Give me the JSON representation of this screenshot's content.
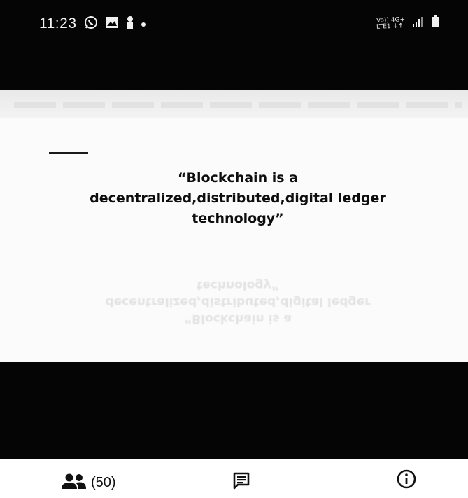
{
  "status_bar": {
    "time": "11:23",
    "network_top": "Vo)) 4G+",
    "network_bottom": "LTE1 ↓↑",
    "left_icons": [
      "whatsapp-icon",
      "gallery-icon",
      "lock-icon",
      "dot-icon"
    ],
    "right_icons": [
      "signal-icon",
      "battery-icon"
    ]
  },
  "main": {
    "quote": "“Blockchain is a decentralized,distributed,digital ledger technology”"
  },
  "bottom_nav": {
    "participants_count": "(50)",
    "items": [
      "participants-icon",
      "chat-icon",
      "info-icon"
    ]
  },
  "colors": {
    "black": "#050505",
    "text": "#0d0d0d",
    "background": "#fbfbfb"
  }
}
